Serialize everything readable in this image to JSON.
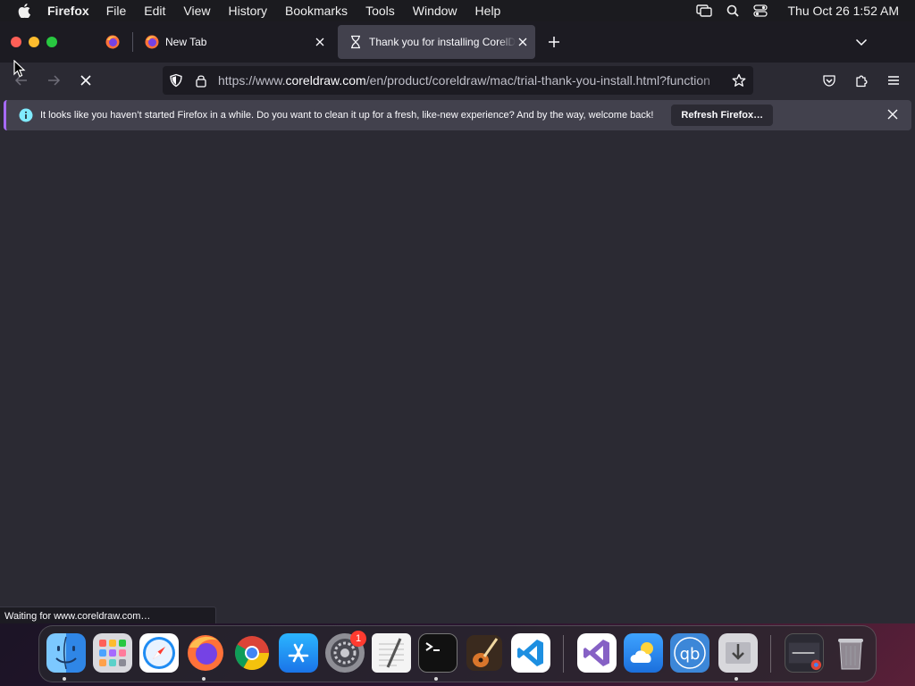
{
  "menubar": {
    "app_name": "Firefox",
    "items": [
      "File",
      "Edit",
      "View",
      "History",
      "Bookmarks",
      "Tools",
      "Window",
      "Help"
    ],
    "clock": "Thu Oct 26  1:52 AM"
  },
  "tabs": [
    {
      "label": "New Tab",
      "icon": "firefox-icon"
    },
    {
      "label": "Thank you for installing CorelDRAW",
      "icon": "hourglass-icon",
      "active": true
    }
  ],
  "navbar": {
    "url_prefix": "https://www.",
    "url_domain": "coreldraw.com",
    "url_path": "/en/product/coreldraw/mac/trial-thank-you-install.html?function"
  },
  "notification": {
    "message": "It looks like you haven’t started Firefox in a while. Do you want to clean it up for a fresh, like-new experience? And by the way, welcome back!",
    "button_label": "Refresh Firefox…"
  },
  "status": "Waiting for www.coreldraw.com…",
  "dock": {
    "apps": [
      "Finder",
      "Launchpad",
      "Safari",
      "Firefox",
      "Chrome",
      "App Store",
      "System Settings",
      "TextEdit",
      "Terminal",
      "GarageBand",
      "Visual Studio Code",
      "Visual Studio",
      "Weather",
      "qBittorrent",
      "Installer",
      "Google Chrome Window",
      "Trash"
    ],
    "settings_badge": "1"
  },
  "colors": {
    "accent_purple": "#a66aff",
    "background": "#2b2a33",
    "tabstrip": "#1c1b22"
  }
}
